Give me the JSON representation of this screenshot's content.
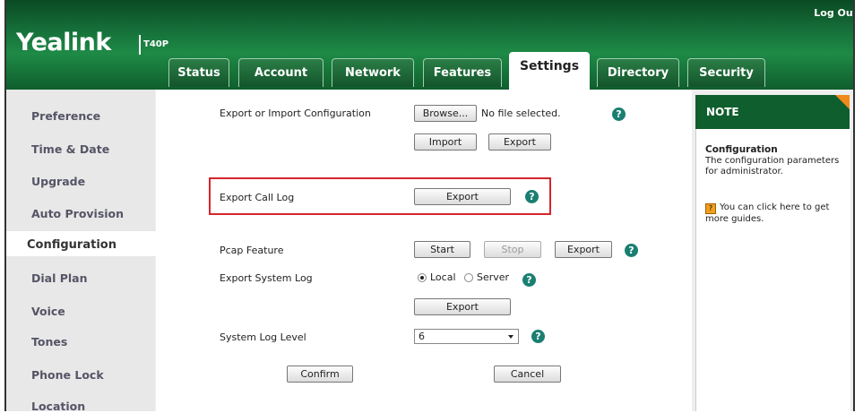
{
  "header": {
    "logo_text": "Yealink",
    "model": "T40P",
    "logout": "Log Out"
  },
  "tabs": [
    {
      "label": "Status"
    },
    {
      "label": "Account"
    },
    {
      "label": "Network"
    },
    {
      "label": "Features"
    },
    {
      "label": "Settings",
      "active": true
    },
    {
      "label": "Directory"
    },
    {
      "label": "Security"
    }
  ],
  "sidebar": {
    "items": [
      {
        "label": "Preference"
      },
      {
        "label": "Time & Date"
      },
      {
        "label": "Upgrade"
      },
      {
        "label": "Auto Provision"
      },
      {
        "label": "Configuration",
        "active": true
      },
      {
        "label": "Dial Plan"
      },
      {
        "label": "Voice"
      },
      {
        "label": "Tones"
      },
      {
        "label": "Phone Lock"
      },
      {
        "label": "Location"
      }
    ]
  },
  "config": {
    "export_import_label": "Export or Import Configuration",
    "browse_button": "Browse...",
    "file_status": "No file selected.",
    "import_button": "Import",
    "export_button": "Export",
    "export_call_log_label": "Export Call Log",
    "call_log_export_button": "Export",
    "pcap_label": "Pcap Feature",
    "pcap_start": "Start",
    "pcap_stop": "Stop",
    "pcap_export": "Export",
    "system_log_label": "Export System Log",
    "radio_local": "Local",
    "radio_server": "Server",
    "system_log_selected": "Local",
    "system_log_export": "Export",
    "log_level_label": "System Log Level",
    "log_level_value": "6",
    "confirm_button": "Confirm",
    "cancel_button": "Cancel"
  },
  "note": {
    "title": "NOTE",
    "subtitle": "Configuration",
    "text": "The configuration parameters for administrator.",
    "guide_icon": "?",
    "guide": "You can click here to get more guides."
  },
  "icons": {
    "help": "?"
  },
  "colors": {
    "header_green": "#16713a",
    "help_teal": "#1a7f72",
    "highlight_red": "#d6262c",
    "note_corner_orange": "#f08a1c"
  }
}
